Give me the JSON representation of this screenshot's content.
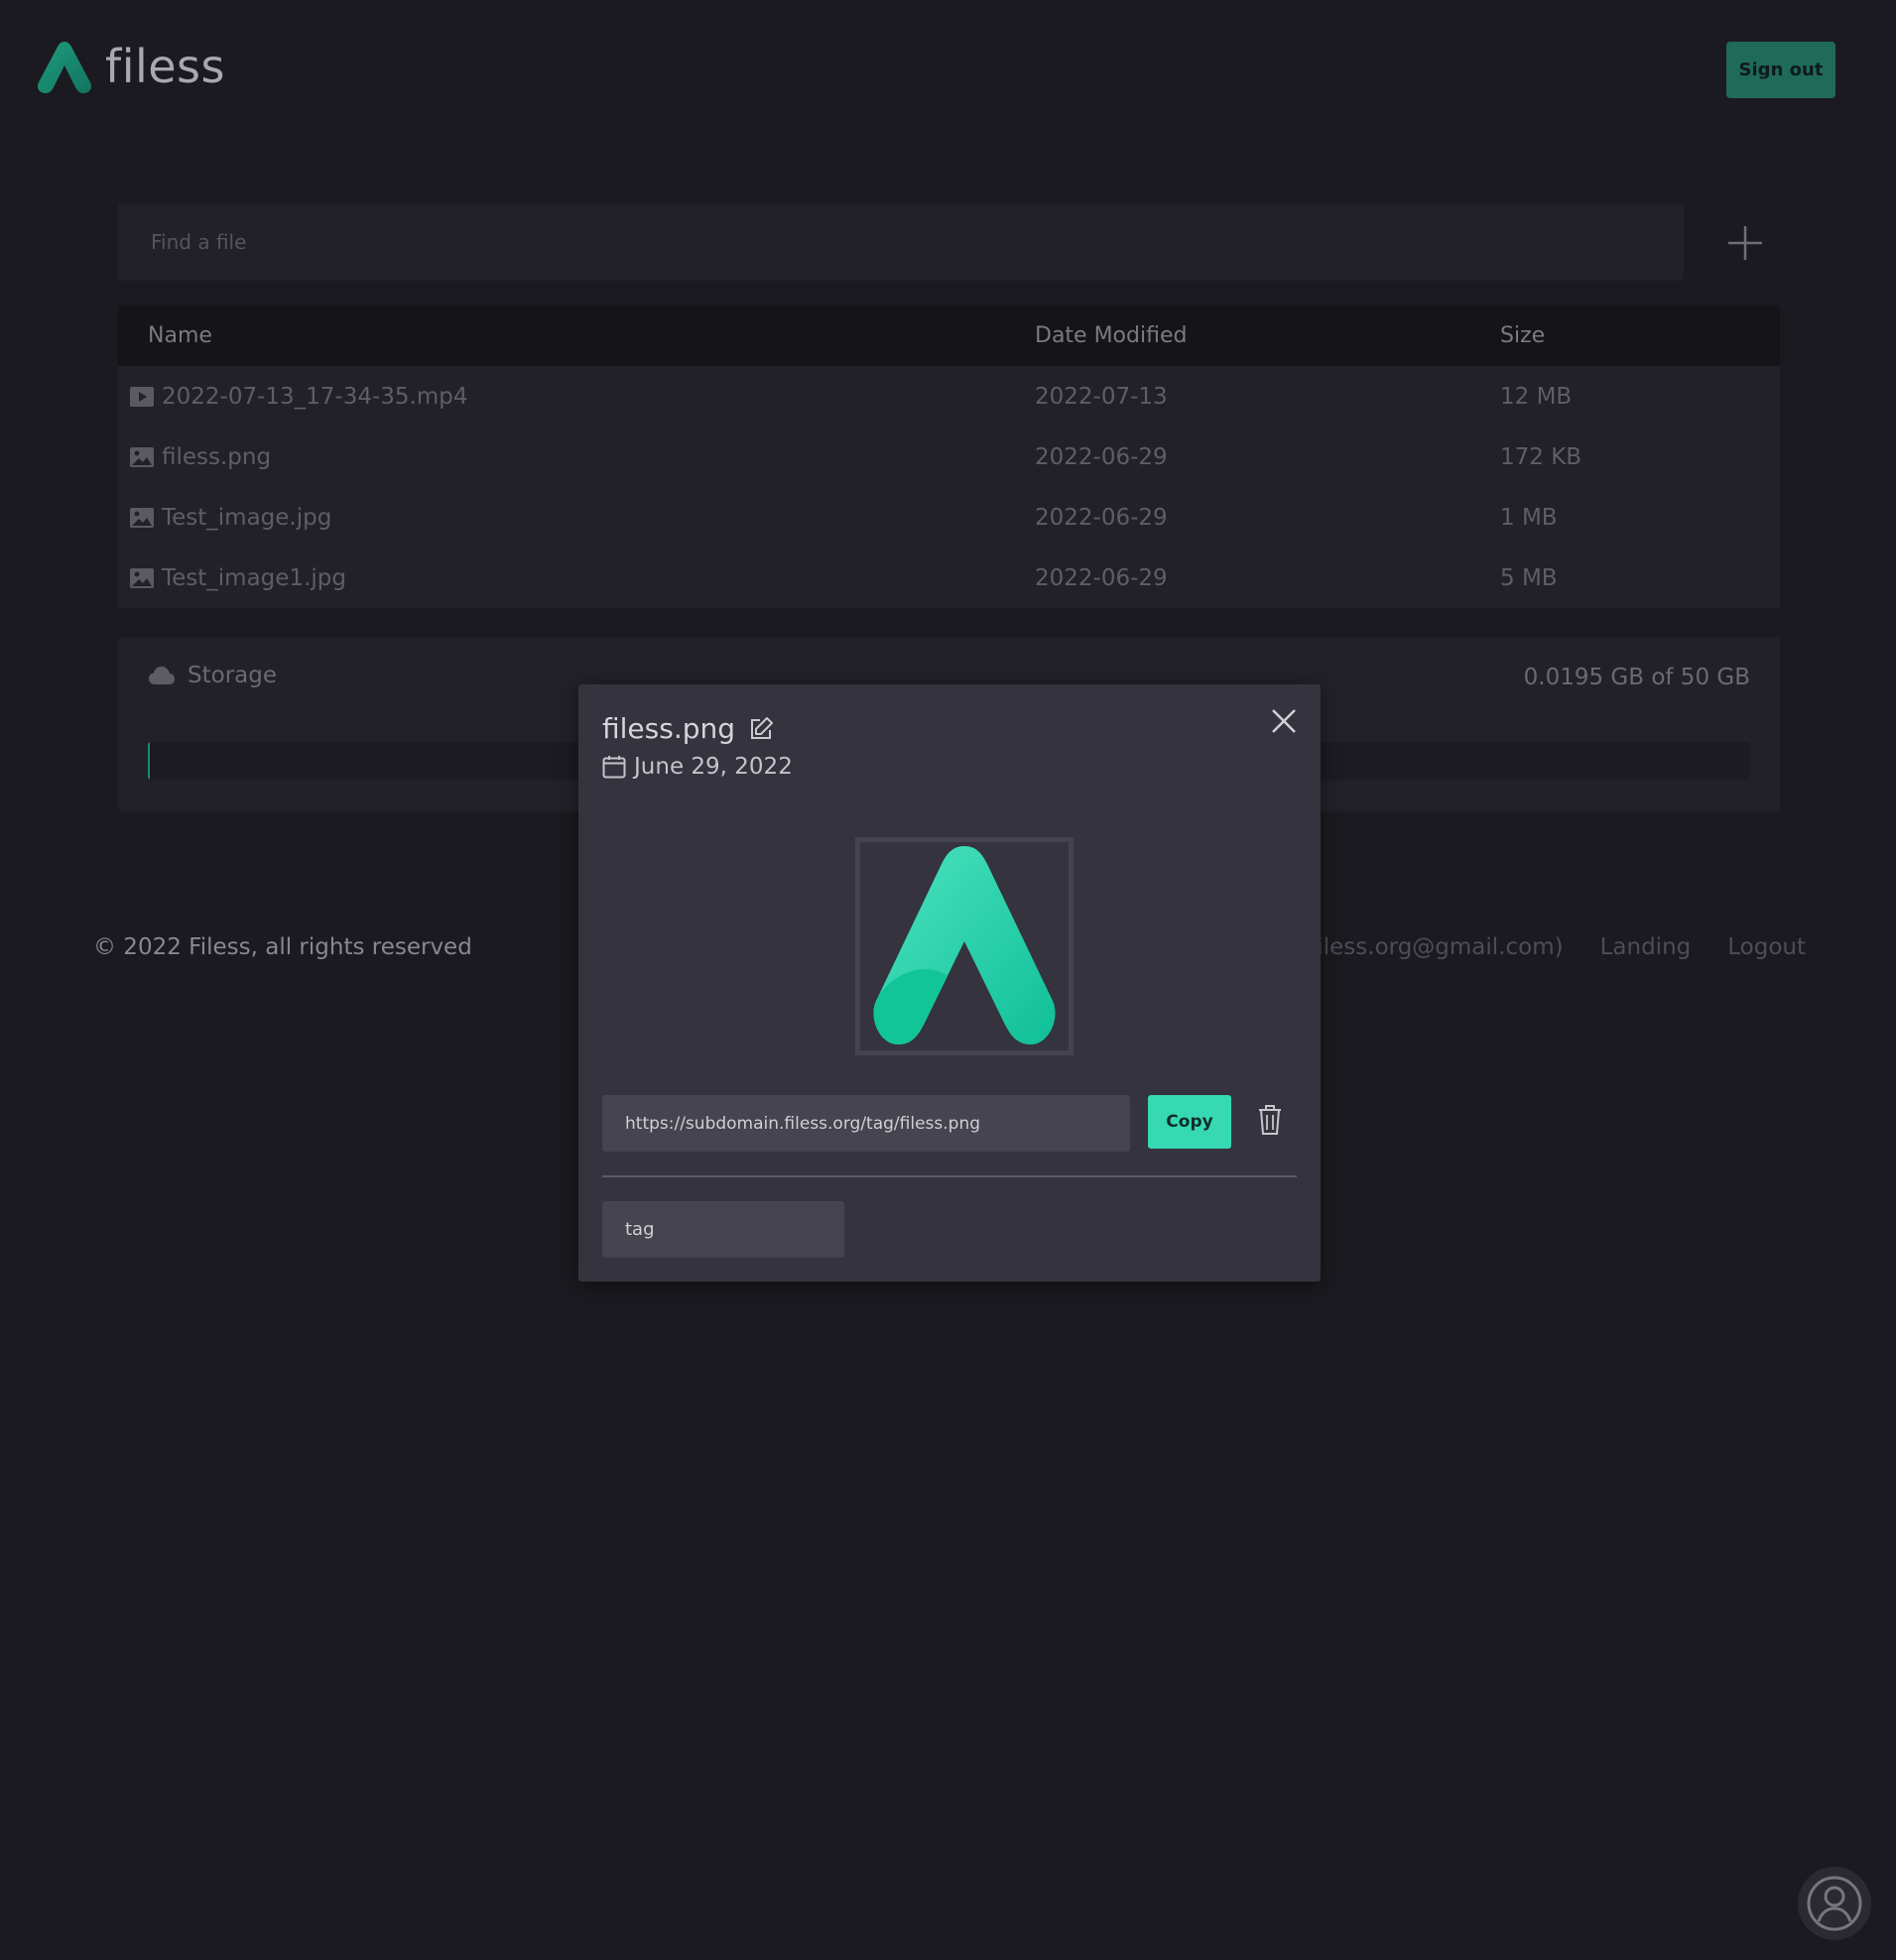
{
  "brand": {
    "name": "filess",
    "accent": "#1fae8a"
  },
  "header": {
    "signout_label": "Sign out"
  },
  "search": {
    "placeholder": "Find a file",
    "value": ""
  },
  "table": {
    "headers": [
      "Name",
      "Date Modified",
      "Size"
    ],
    "rows": [
      {
        "icon": "video-file-icon",
        "name": "2022-07-13_17-34-35.mp4",
        "date": "2022-07-13",
        "size": "12 MB"
      },
      {
        "icon": "image-file-icon",
        "name": "filess.png",
        "date": "2022-06-29",
        "size": "172 KB"
      },
      {
        "icon": "image-file-icon",
        "name": "Test_image.jpg",
        "date": "2022-06-29",
        "size": "1 MB"
      },
      {
        "icon": "image-file-icon",
        "name": "Test_image1.jpg",
        "date": "2022-06-29",
        "size": "5 MB"
      }
    ]
  },
  "storage": {
    "label": "Storage",
    "value": "0.0195 GB of 50 GB",
    "used_fraction": 0.0004
  },
  "footer": {
    "copyright": "© 2022 Filess, all rights reserved",
    "links": [
      "Contact (filess.org@gmail.com)",
      "Landing",
      "Logout"
    ]
  },
  "modal": {
    "title": "filess.png",
    "date": "June 29, 2022",
    "url": "https://subdomain.filess.org/tag/filess.png",
    "copy_label": "Copy",
    "tag_value": "tag"
  }
}
